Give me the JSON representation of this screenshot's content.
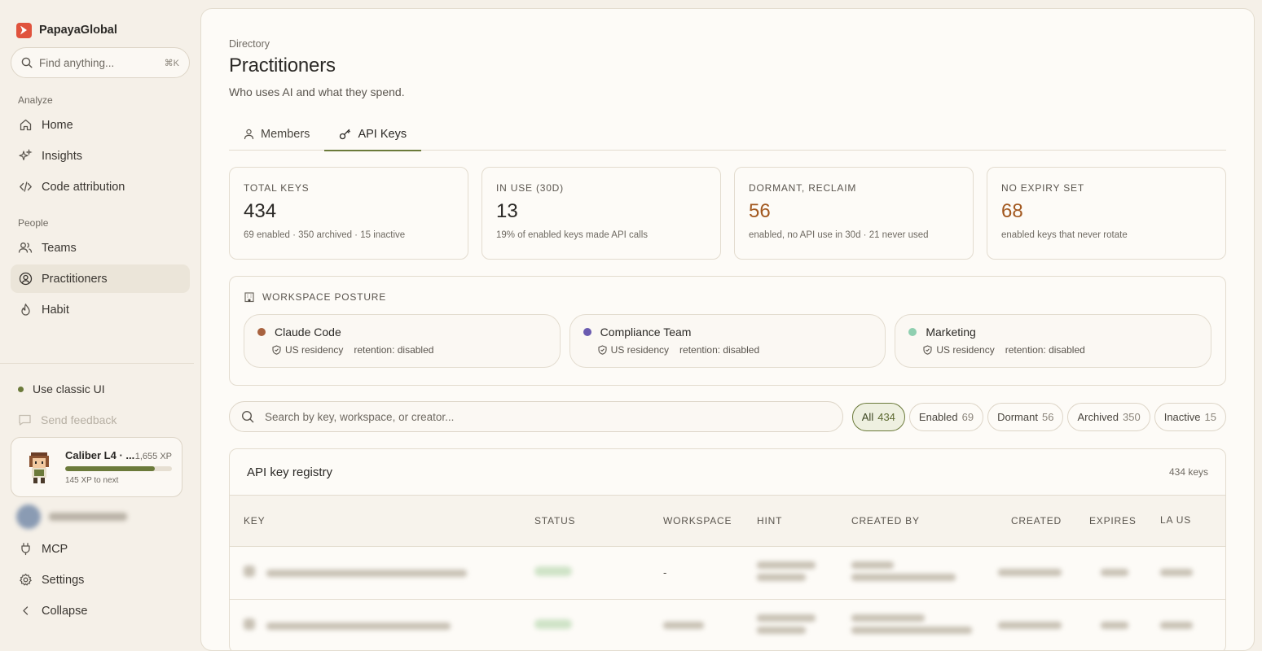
{
  "brand": {
    "name": "PapayaGlobal"
  },
  "sidebar": {
    "search_placeholder": "Find anything...",
    "search_shortcut": "⌘K",
    "sections": [
      {
        "label": "Analyze",
        "items": [
          {
            "label": "Home",
            "icon": "home-icon"
          },
          {
            "label": "Insights",
            "icon": "sparkle-icon"
          },
          {
            "label": "Code attribution",
            "icon": "code-icon"
          }
        ]
      },
      {
        "label": "People",
        "items": [
          {
            "label": "Teams",
            "icon": "users-icon"
          },
          {
            "label": "Practitioners",
            "icon": "user-circle-icon",
            "active": true
          },
          {
            "label": "Habit",
            "icon": "flame-icon"
          }
        ]
      }
    ],
    "classic_ui_label": "Use classic UI",
    "feedback_label": "Send feedback",
    "xp_card": {
      "title": "Caliber L4 · ...",
      "xp": "1,655 XP",
      "progress": 0.84,
      "next": "145 XP to next"
    },
    "bottom_items": [
      {
        "label": "MCP",
        "icon": "plug-icon"
      },
      {
        "label": "Settings",
        "icon": "gear-icon"
      },
      {
        "label": "Collapse",
        "icon": "chevron-left-icon"
      }
    ]
  },
  "page": {
    "breadcrumb": "Directory",
    "title": "Practitioners",
    "subtitle": "Who uses AI and what they spend.",
    "tabs": [
      {
        "label": "Members",
        "icon": "person-icon"
      },
      {
        "label": "API Keys",
        "icon": "key-icon",
        "active": true
      }
    ]
  },
  "stats": [
    {
      "label": "TOTAL KEYS",
      "value": "434",
      "note": "69 enabled · 350 archived · 15 inactive",
      "warn": false
    },
    {
      "label": "IN USE (30D)",
      "value": "13",
      "note": "19% of enabled keys made API calls",
      "warn": false
    },
    {
      "label": "DORMANT, RECLAIM",
      "value": "56",
      "note": "enabled, no API use in 30d · 21 never used",
      "warn": true
    },
    {
      "label": "NO EXPIRY SET",
      "value": "68",
      "note": "enabled keys that never rotate",
      "warn": true
    }
  ],
  "posture": {
    "heading": "WORKSPACE POSTURE",
    "workspaces": [
      {
        "name": "Claude Code",
        "dot_color": "#a8623f",
        "residency": "US residency",
        "retention": "retention: disabled"
      },
      {
        "name": "Compliance Team",
        "dot_color": "#6a5bb0",
        "residency": "US residency",
        "retention": "retention: disabled"
      },
      {
        "name": "Marketing",
        "dot_color": "#8fcfb0",
        "residency": "US residency",
        "retention": "retention: disabled"
      }
    ]
  },
  "filters": {
    "search_placeholder": "Search by key, workspace, or creator...",
    "chips": [
      {
        "label": "All",
        "count": "434",
        "active": true
      },
      {
        "label": "Enabled",
        "count": "69"
      },
      {
        "label": "Dormant",
        "count": "56"
      },
      {
        "label": "Archived",
        "count": "350"
      },
      {
        "label": "Inactive",
        "count": "15"
      }
    ]
  },
  "registry": {
    "title": "API key registry",
    "count": "434 keys",
    "columns": [
      "KEY",
      "STATUS",
      "WORKSPACE",
      "HINT",
      "CREATED BY",
      "CREATED",
      "EXPIRES",
      "LA US"
    ],
    "rows": [
      {
        "workspace": "-"
      },
      {
        "workspace": ""
      }
    ]
  },
  "colors": {
    "accent": "#6b7a3a",
    "warn": "#a2581f",
    "brand": "#e0533d"
  }
}
